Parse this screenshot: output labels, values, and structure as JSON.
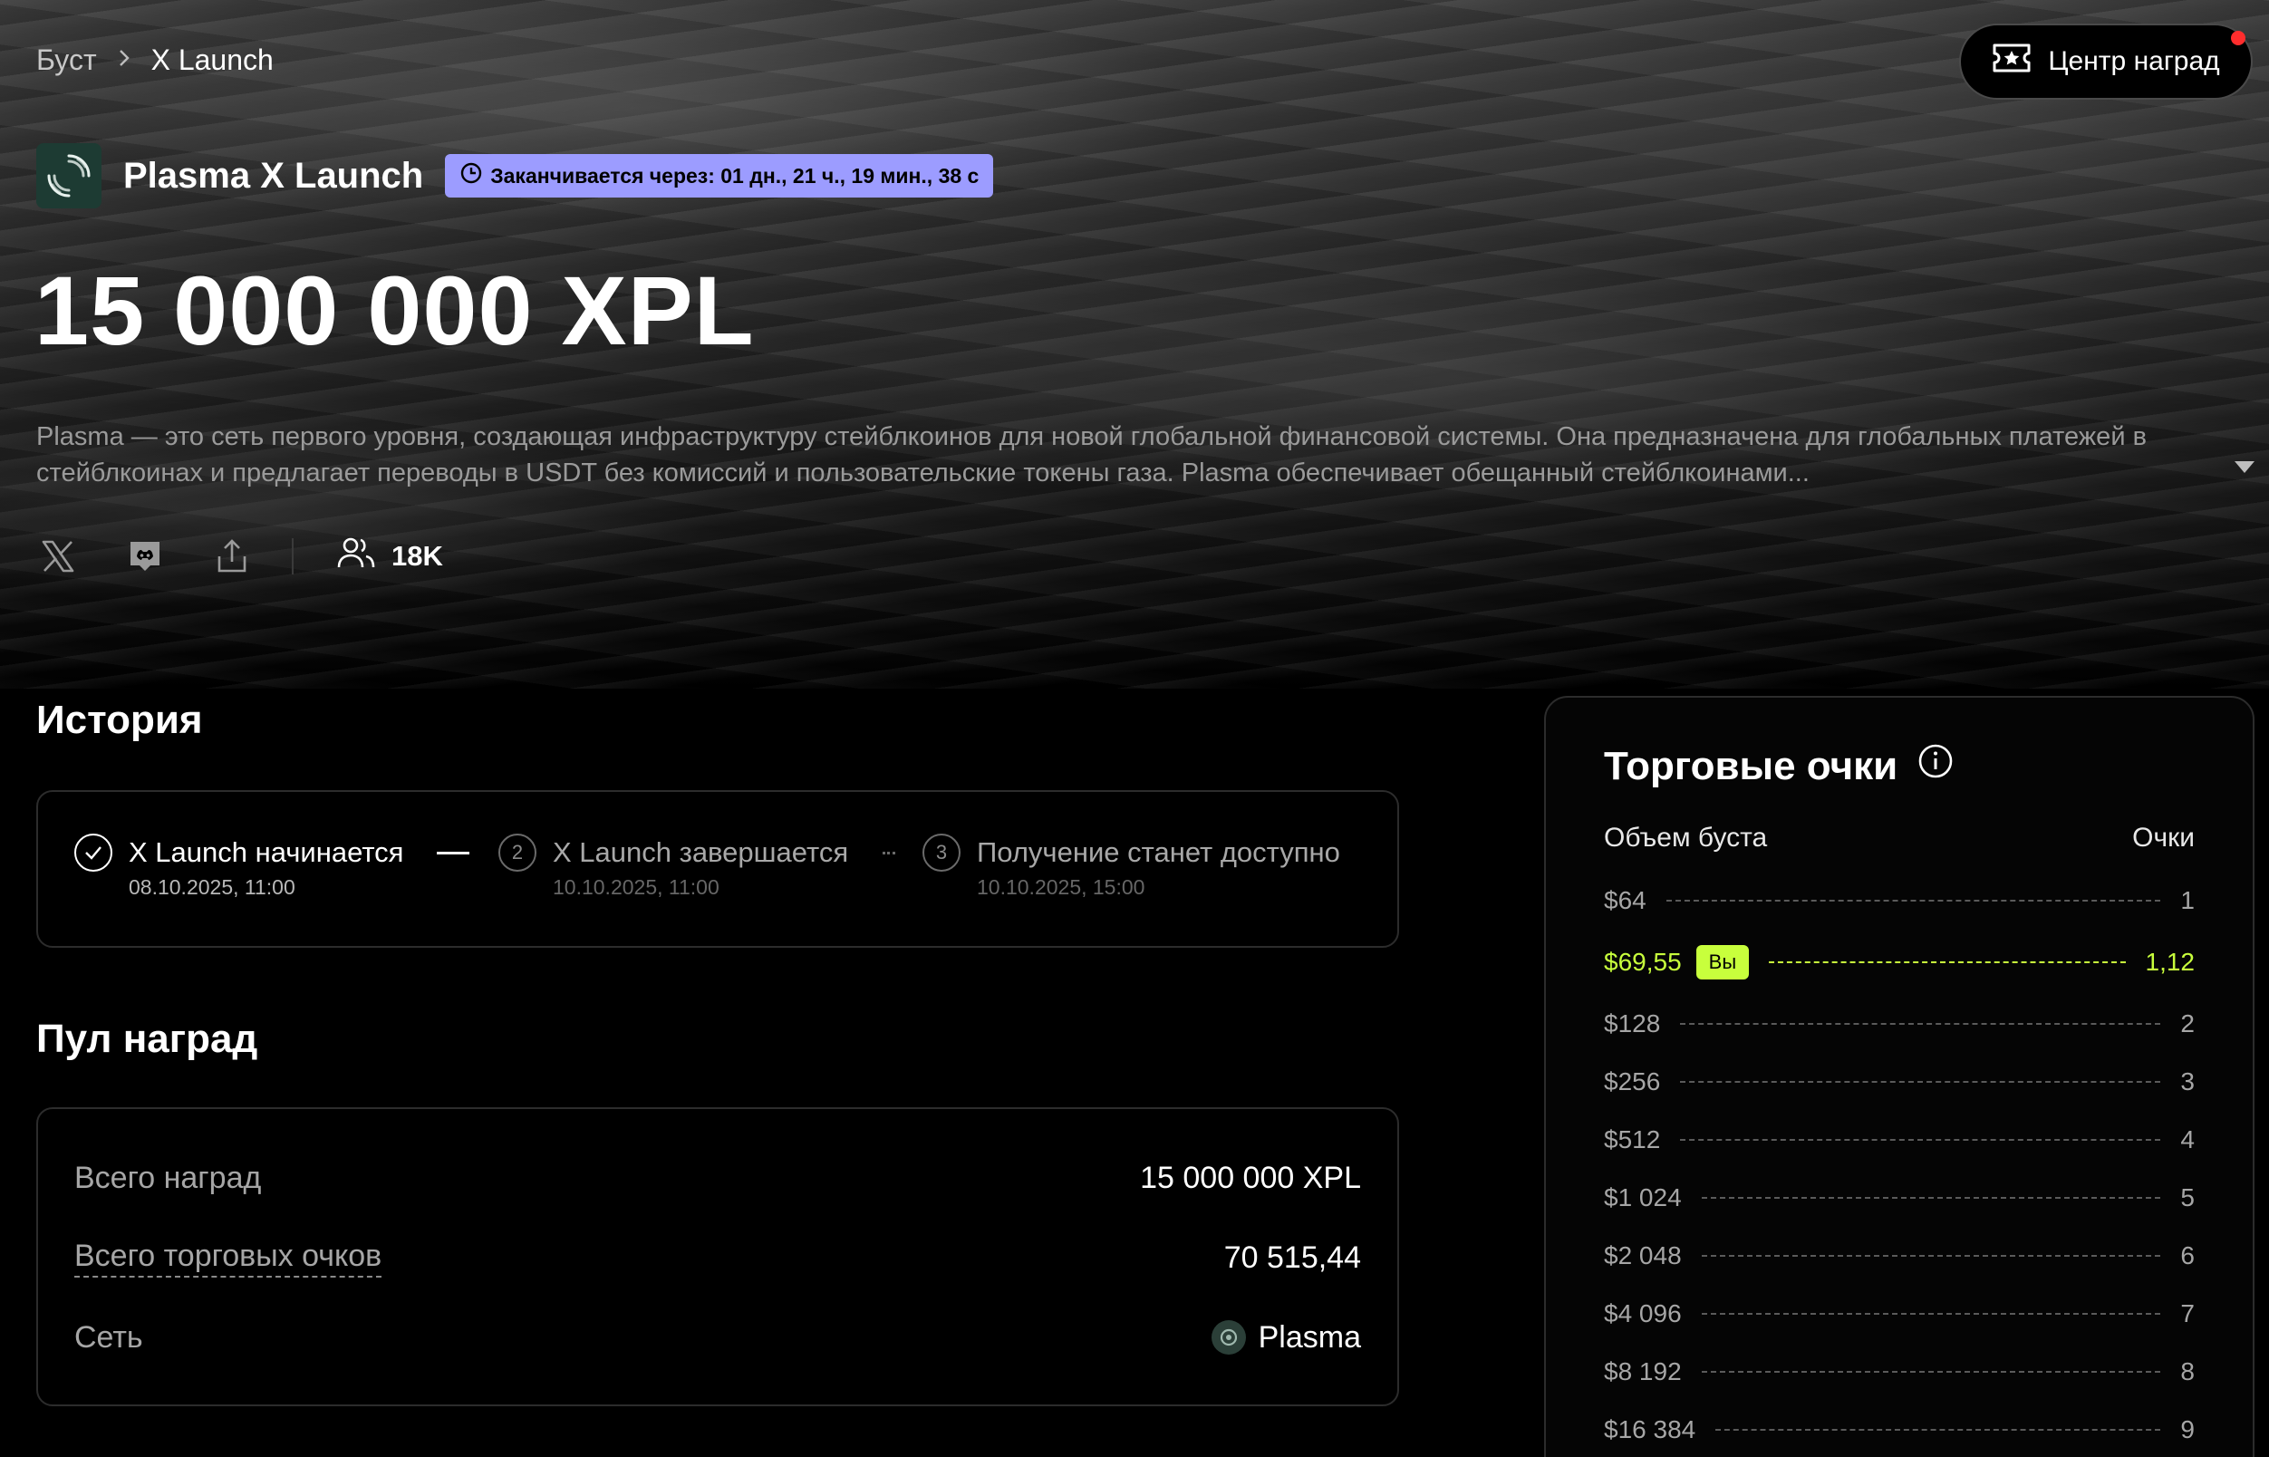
{
  "breadcrumb": {
    "root": "Буст",
    "current": "X Launch"
  },
  "rewards_center": {
    "label": "Центр наград"
  },
  "project": {
    "name": "Plasma X Launch",
    "countdown": "Заканчивается через: 01 дн., 21 ч., 19 мин., 38 с",
    "amount": "15 000 000 XPL",
    "description": "Plasma — это сеть первого уровня, создающая инфраструктуру стейблкоинов для новой глобальной финансовой системы. Она предназначена для глобальных платежей в стейблкоинах и предлагает переводы в USDT без комиссий и пользовательские токены газа. Plasma обеспечивает обещанный стейблкоинами...",
    "followers": "18K"
  },
  "history": {
    "title": "История",
    "steps": [
      {
        "num": "1",
        "title": "X Launch начинается",
        "date": "08.10.2025, 11:00"
      },
      {
        "num": "2",
        "title": "X Launch завершается",
        "date": "10.10.2025, 11:00"
      },
      {
        "num": "3",
        "title": "Получение станет доступно",
        "date": "10.10.2025, 15:00"
      }
    ]
  },
  "pool": {
    "title": "Пул наград",
    "rows": [
      {
        "label": "Всего наград",
        "value": "15 000 000 XPL"
      },
      {
        "label": "Всего торговых очков",
        "value": "70 515,44"
      },
      {
        "label": "Сеть",
        "value": "Plasma"
      }
    ]
  },
  "trading_points": {
    "title": "Торговые очки",
    "col_volume": "Объем буста",
    "col_points": "Очки",
    "you_label": "Вы",
    "rows": [
      {
        "volume": "$64",
        "points": "1"
      },
      {
        "volume": "$69,55",
        "points": "1,12"
      },
      {
        "volume": "$128",
        "points": "2"
      },
      {
        "volume": "$256",
        "points": "3"
      },
      {
        "volume": "$512",
        "points": "4"
      },
      {
        "volume": "$1 024",
        "points": "5"
      },
      {
        "volume": "$2 048",
        "points": "6"
      },
      {
        "volume": "$4 096",
        "points": "7"
      },
      {
        "volume": "$8 192",
        "points": "8"
      },
      {
        "volume": "$16 384",
        "points": "9"
      }
    ]
  },
  "colors": {
    "accent_lime": "#c8ff3c",
    "countdown_bg": "#9c9cff",
    "notification": "#ff2d2d"
  },
  "icons": [
    "chevron-right-icon",
    "ticket-star-icon",
    "plasma-logo-icon",
    "clock-icon",
    "x-twitter-icon",
    "discord-icon",
    "share-icon",
    "users-icon",
    "check-icon",
    "info-icon",
    "caret-down-icon"
  ]
}
